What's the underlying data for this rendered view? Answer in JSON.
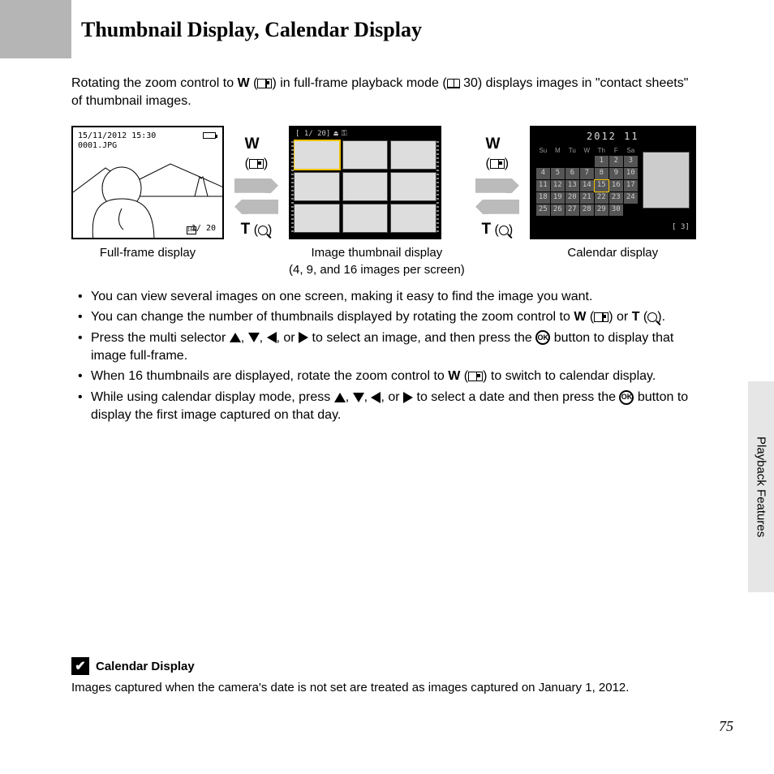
{
  "title": "Thumbnail Display, Calendar Display",
  "intro_pre": "Rotating the zoom control to ",
  "intro_w": "W",
  "intro_mid": " in full-frame playback mode (",
  "intro_ref": "30",
  "intro_post": ") displays images in \"contact sheets\" of thumbnail images.",
  "fullframe": {
    "caption": "Full-frame display",
    "osd_datetime": "15/11/2012 15:30",
    "osd_filename": "0001.JPG",
    "osd_count": "1/  20",
    "osd_size": "16M"
  },
  "arrows": {
    "w": "W",
    "t": "T"
  },
  "thumbs": {
    "osd_count": "[   1/  20]",
    "caption": "Image thumbnail display",
    "subcaption": "(4, 9, and 16 images per screen)"
  },
  "calendar": {
    "title": "2012  11",
    "days": [
      "Su",
      "M",
      "Tu",
      "W",
      "Th",
      "F",
      "Sa"
    ],
    "weeks": [
      [
        "",
        "",
        "",
        "",
        "1",
        "2",
        "3"
      ],
      [
        "4",
        "5",
        "6",
        "7",
        "8",
        "9",
        "10"
      ],
      [
        "11",
        "12",
        "13",
        "14",
        "15",
        "16",
        "17"
      ],
      [
        "18",
        "19",
        "20",
        "21",
        "22",
        "23",
        "24"
      ],
      [
        "25",
        "26",
        "27",
        "28",
        "29",
        "30",
        ""
      ]
    ],
    "selected": "15",
    "count": "[      3]",
    "caption": "Calendar display"
  },
  "bullets": {
    "b1": "You can view several images on one screen, making it easy to find the image you want.",
    "b2_pre": "You can change the number of thumbnails displayed by rotating the zoom control to ",
    "b2_w": "W",
    "b2_or": " or ",
    "b2_t": "T",
    "b2_post": ".",
    "b3_pre": "Press the multi selector ",
    "b3_mid": " to select an image, and then press the ",
    "b3_post": " button to display that image full-frame.",
    "or": ", or ",
    "comma": ", ",
    "b4_pre": "When 16 thumbnails are displayed, rotate the zoom control to ",
    "b4_w": "W",
    "b4_post": " to switch to calendar display.",
    "b5_pre": "While using calendar display mode, press ",
    "b5_mid": " to select a date and then press the ",
    "b5_post": " button to display the first image captured on that day."
  },
  "ok_label": "OK",
  "side_tab": "Playback Features",
  "note": {
    "heading": "Calendar Display",
    "text": "Images captured when the camera's date is not set are treated as images captured on January 1, 2012."
  },
  "page_number": "75"
}
